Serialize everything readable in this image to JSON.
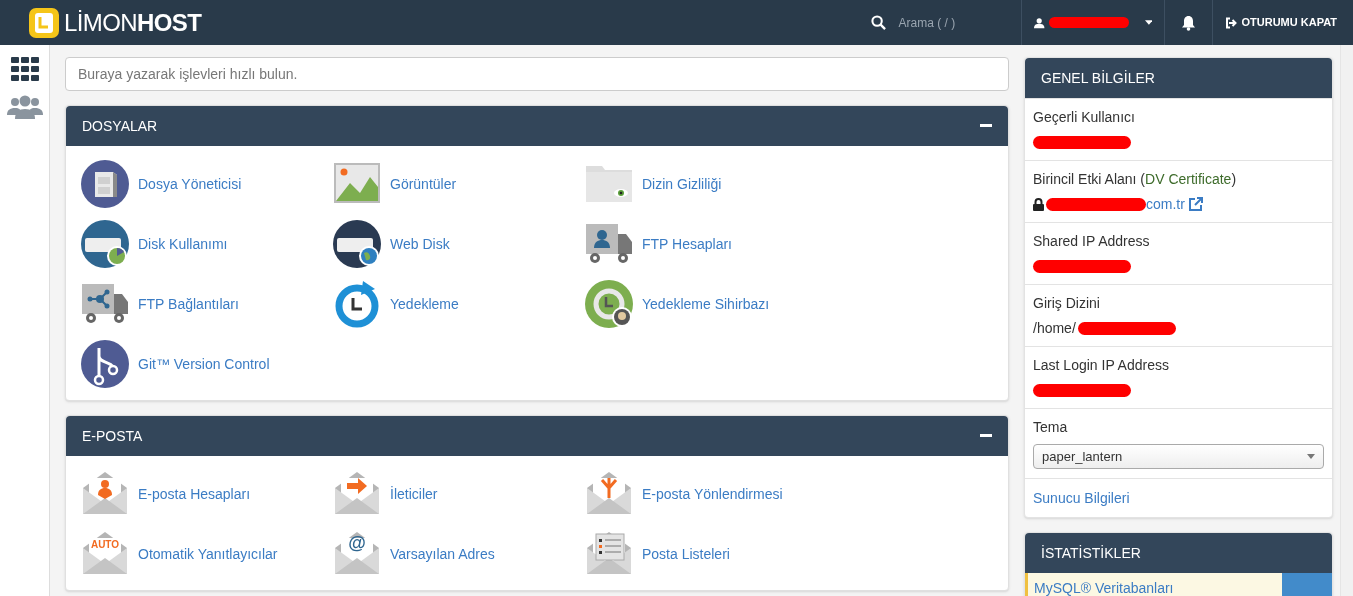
{
  "topbar": {
    "logo": {
      "light": "LİMON",
      "bold": "HOST"
    },
    "search": {
      "placeholder": "Arama ( / )"
    },
    "logout": "OTURUMU KAPAT"
  },
  "quick_search": {
    "placeholder": "Buraya yazarak işlevleri hızlı bulun."
  },
  "sections": [
    {
      "title": "DOSYALAR",
      "expanded": true,
      "items": [
        {
          "label": "Dosya Yöneticisi",
          "kind": "cabinet"
        },
        {
          "label": "Görüntüler",
          "kind": "image"
        },
        {
          "label": "Dizin Gizliliği",
          "kind": "folder"
        },
        {
          "label": "Disk Kullanımı",
          "kind": "disk"
        },
        {
          "label": "Web Disk",
          "kind": "webdisk"
        },
        {
          "label": "FTP Hesapları",
          "kind": "truck-user"
        },
        {
          "label": "FTP Bağlantıları",
          "kind": "truck-network"
        },
        {
          "label": "Yedekleme",
          "kind": "backup"
        },
        {
          "label": "Yedekleme Sihirbazı",
          "kind": "wizard"
        },
        {
          "label": "Git™ Version Control",
          "kind": "git"
        }
      ]
    },
    {
      "title": "E-POSTA",
      "expanded": true,
      "items": [
        {
          "label": "E-posta Hesapları",
          "kind": "mail-user"
        },
        {
          "label": "İleticiler",
          "kind": "mail-arrow"
        },
        {
          "label": "E-posta Yönlendirmesi",
          "kind": "mail-fork"
        },
        {
          "label": "Otomatik Yanıtlayıcılar",
          "kind": "mail-auto",
          "badge": "AUTO"
        },
        {
          "label": "Varsayılan Adres",
          "kind": "mail-at",
          "badge": "@"
        },
        {
          "label": "Posta Listeleri",
          "kind": "mail-list"
        }
      ]
    }
  ],
  "general_info": {
    "title": "GENEL BİLGİLER",
    "rows": [
      {
        "kind": "redacted",
        "label": "Geçerli Kullanıcı"
      },
      {
        "kind": "domain",
        "label": "Birincil Etki Alanı (",
        "link": "DV Certificate",
        "suffix": ")",
        "value": "com.tr"
      },
      {
        "kind": "redacted",
        "label": "Shared IP Address"
      },
      {
        "kind": "path",
        "label": "Giriş Dizini",
        "value": "/home/"
      },
      {
        "kind": "redacted",
        "label": "Last Login IP Address"
      },
      {
        "kind": "select",
        "label": "Tema",
        "value": "paper_lantern"
      },
      {
        "kind": "link",
        "label": "Sunucu Bilgileri"
      }
    ]
  },
  "statistics": {
    "title": "İSTATİSTİKLER",
    "rows": [
      {
        "label": "MySQL® Veritabanları"
      }
    ]
  }
}
